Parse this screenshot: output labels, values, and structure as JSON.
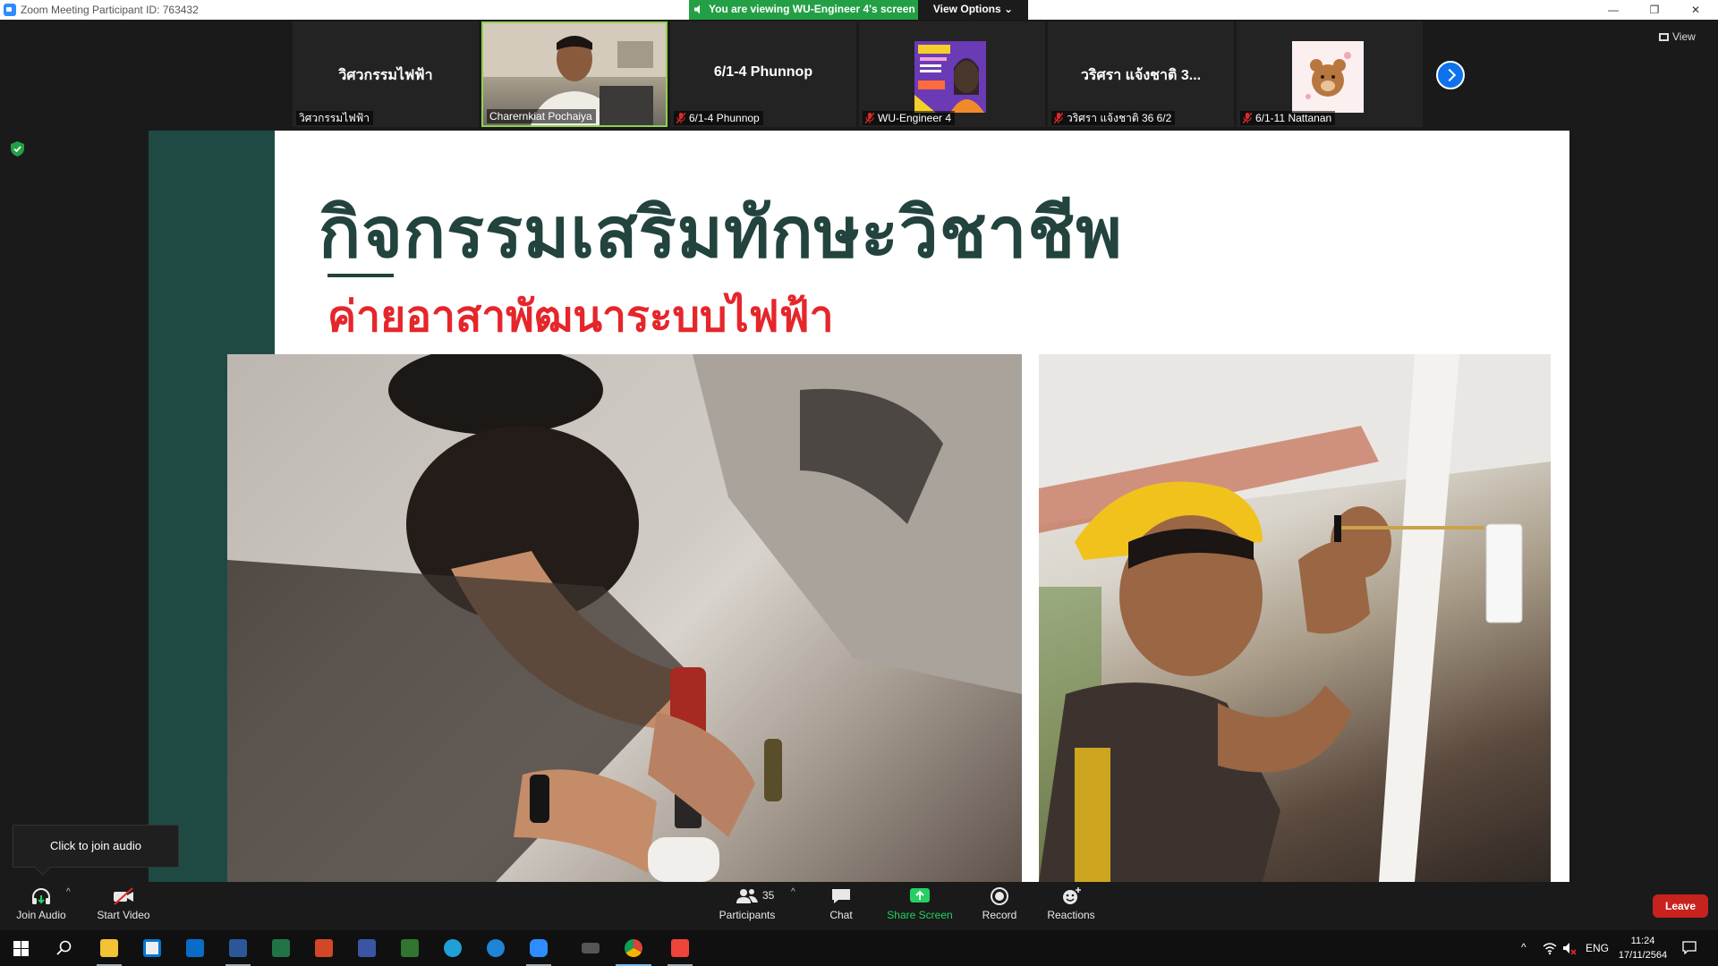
{
  "window": {
    "title": "Zoom Meeting Participant ID: 763432",
    "viewing_banner": "You are viewing WU-Engineer 4's screen",
    "view_options_label": "View Options",
    "view_label": "View"
  },
  "participants_strip": [
    {
      "display": "วิศวกรรมไฟฟ้า",
      "label": "วิศวกรรมไฟฟ้า",
      "muted": false
    },
    {
      "display": "",
      "label": "Charernkiat Pochaiya",
      "muted": false
    },
    {
      "display": "6/1-4 Phunnop",
      "label": "6/1-4 Phunnop",
      "muted": true
    },
    {
      "display": "",
      "label": "WU-Engineer 4",
      "muted": true
    },
    {
      "display": "วริศรา แจ้งชาติ 3...",
      "label": "วริศรา แจ้งชาติ 36 6/2",
      "muted": true
    },
    {
      "display": "",
      "label": "6/1-11 Nattanan",
      "muted": true
    }
  ],
  "slide": {
    "title": "กิจกรรมเสริมทักษะวิชาชีพ",
    "subtitle": "ค่ายอาสาพัฒนาระบบไฟฟ้า",
    "band_color": "#1f4a44",
    "title_color": "#22433e",
    "subtitle_color": "#e5262b"
  },
  "audio_tooltip": "Click to join audio",
  "toolbar": {
    "join_audio": "Join Audio",
    "start_video": "Start Video",
    "participants": "Participants",
    "participants_count": "35",
    "chat": "Chat",
    "share_screen": "Share Screen",
    "record": "Record",
    "reactions": "Reactions",
    "leave": "Leave"
  },
  "taskbar": {
    "language": "ENG",
    "time": "11:24",
    "date": "17/11/2564"
  },
  "icons": {
    "app": "zoom-icon",
    "security": "shield-check-icon",
    "next": "chevron-right-icon",
    "mic_off": "mic-off-icon"
  },
  "colors": {
    "zoom_blue": "#0e72ed",
    "banner_green": "#23a045",
    "leave_red": "#c8221f",
    "share_green": "#23d160"
  }
}
